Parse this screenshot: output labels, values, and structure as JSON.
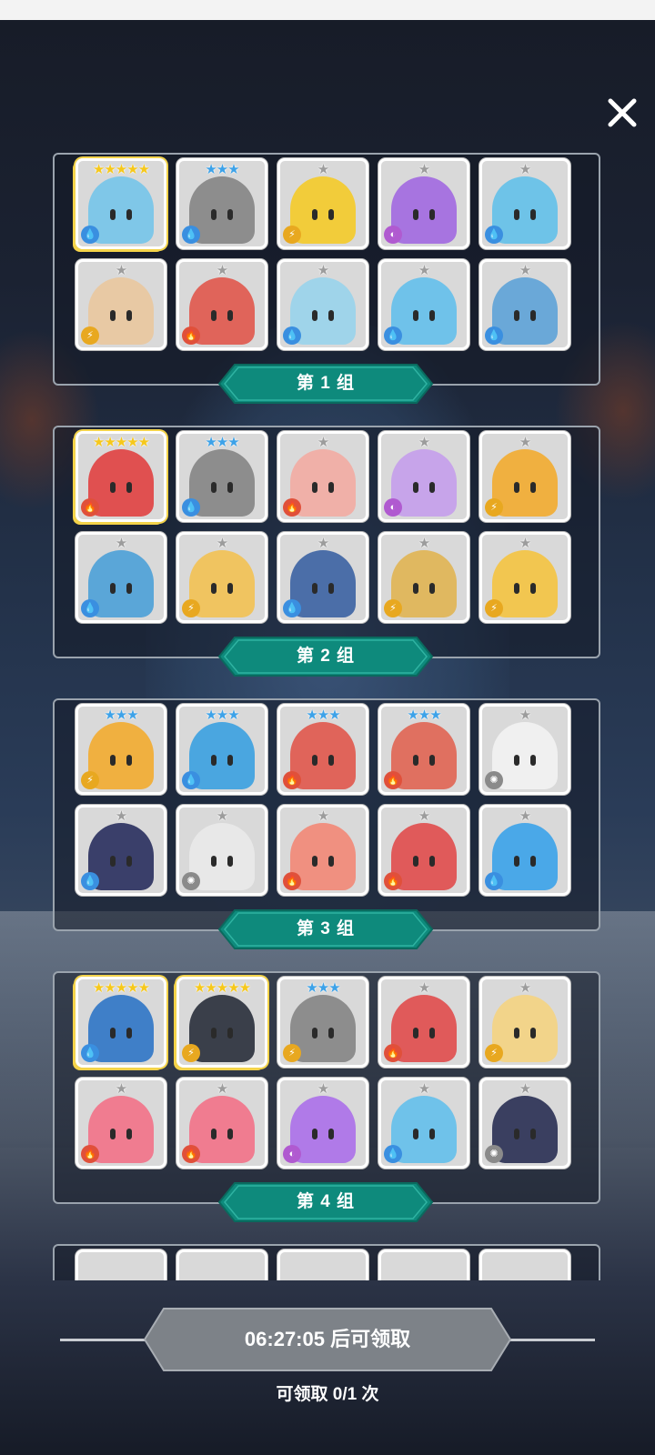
{
  "close_icon": "close-icon",
  "groups": [
    {
      "label": "第 1 组",
      "cards": [
        {
          "stars": 5,
          "star_color": "gold",
          "element": "water",
          "hero_color": "#7fc7e8"
        },
        {
          "stars": 3,
          "star_color": "blue",
          "element": "water",
          "hero_color": "#8d8d8d"
        },
        {
          "stars": 1,
          "star_color": "silver",
          "element": "lightning",
          "hero_color": "#f2cc3a"
        },
        {
          "stars": 1,
          "star_color": "silver",
          "element": "dark",
          "hero_color": "#a774e0"
        },
        {
          "stars": 1,
          "star_color": "silver",
          "element": "water",
          "hero_color": "#6ec3e8"
        },
        {
          "stars": 1,
          "star_color": "silver",
          "element": "lightning",
          "hero_color": "#e8c9a4"
        },
        {
          "stars": 1,
          "star_color": "silver",
          "element": "fire",
          "hero_color": "#e0645a"
        },
        {
          "stars": 1,
          "star_color": "silver",
          "element": "water",
          "hero_color": "#9fd4ea"
        },
        {
          "stars": 1,
          "star_color": "silver",
          "element": "water",
          "hero_color": "#6fc2ea"
        },
        {
          "stars": 1,
          "star_color": "silver",
          "element": "water",
          "hero_color": "#6aa8d8"
        }
      ]
    },
    {
      "label": "第 2 组",
      "cards": [
        {
          "stars": 5,
          "star_color": "gold",
          "element": "fire",
          "hero_color": "#e05050"
        },
        {
          "stars": 3,
          "star_color": "blue",
          "element": "water",
          "hero_color": "#8d8d8d"
        },
        {
          "stars": 1,
          "star_color": "silver",
          "element": "fire",
          "hero_color": "#f0b0a8"
        },
        {
          "stars": 1,
          "star_color": "silver",
          "element": "dark",
          "hero_color": "#c7a4ea"
        },
        {
          "stars": 1,
          "star_color": "silver",
          "element": "lightning",
          "hero_color": "#f0b040"
        },
        {
          "stars": 1,
          "star_color": "silver",
          "element": "water",
          "hero_color": "#5aa6d8"
        },
        {
          "stars": 1,
          "star_color": "silver",
          "element": "lightning",
          "hero_color": "#f0c460"
        },
        {
          "stars": 1,
          "star_color": "silver",
          "element": "water",
          "hero_color": "#4b6ea8"
        },
        {
          "stars": 1,
          "star_color": "silver",
          "element": "lightning",
          "hero_color": "#e0b860"
        },
        {
          "stars": 1,
          "star_color": "silver",
          "element": "lightning",
          "hero_color": "#f2c650"
        }
      ]
    },
    {
      "label": "第 3 组",
      "cards": [
        {
          "stars": 3,
          "star_color": "blue",
          "element": "lightning",
          "hero_color": "#f0b040"
        },
        {
          "stars": 3,
          "star_color": "blue",
          "element": "water",
          "hero_color": "#4aa6e0"
        },
        {
          "stars": 3,
          "star_color": "blue",
          "element": "fire",
          "hero_color": "#e0645a"
        },
        {
          "stars": 3,
          "star_color": "blue",
          "element": "fire",
          "hero_color": "#e07060"
        },
        {
          "stars": 1,
          "star_color": "silver",
          "element": "light",
          "hero_color": "#f0f0f0"
        },
        {
          "stars": 1,
          "star_color": "silver",
          "element": "water",
          "hero_color": "#3a3f6a"
        },
        {
          "stars": 1,
          "star_color": "silver",
          "element": "light",
          "hero_color": "#e8e8e8"
        },
        {
          "stars": 1,
          "star_color": "silver",
          "element": "fire",
          "hero_color": "#f09080"
        },
        {
          "stars": 1,
          "star_color": "silver",
          "element": "fire",
          "hero_color": "#e05a5a"
        },
        {
          "stars": 1,
          "star_color": "silver",
          "element": "water",
          "hero_color": "#4aa8e8"
        }
      ]
    },
    {
      "label": "第 4 组",
      "cards": [
        {
          "stars": 5,
          "star_color": "gold",
          "element": "water",
          "hero_color": "#3f7fc8"
        },
        {
          "stars": 5,
          "star_color": "gold",
          "element": "lightning",
          "hero_color": "#3a3f4a"
        },
        {
          "stars": 3,
          "star_color": "blue",
          "element": "lightning",
          "hero_color": "#8d8d8d"
        },
        {
          "stars": 1,
          "star_color": "silver",
          "element": "fire",
          "hero_color": "#e05a5a"
        },
        {
          "stars": 1,
          "star_color": "silver",
          "element": "lightning",
          "hero_color": "#f2d48a"
        },
        {
          "stars": 1,
          "star_color": "silver",
          "element": "fire",
          "hero_color": "#f07c90"
        },
        {
          "stars": 1,
          "star_color": "silver",
          "element": "fire",
          "hero_color": "#f07c90"
        },
        {
          "stars": 1,
          "star_color": "silver",
          "element": "dark",
          "hero_color": "#b07ae8"
        },
        {
          "stars": 1,
          "star_color": "silver",
          "element": "water",
          "hero_color": "#6fc2ea"
        },
        {
          "stars": 1,
          "star_color": "silver",
          "element": "light",
          "hero_color": "#3a3f60"
        }
      ]
    }
  ],
  "claim": {
    "button_label": "06:27:05 后可领取",
    "count_label": "可领取 0/1 次"
  },
  "colors": {
    "label_teal": "#0e8a7c",
    "button_gray": "#7d8288",
    "star_gold": "#f6c81c",
    "star_blue": "#3da2e8",
    "star_silver": "#9c9c9c"
  }
}
